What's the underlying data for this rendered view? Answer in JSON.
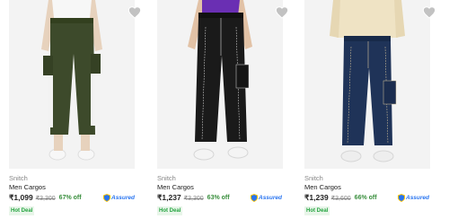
{
  "products": [
    {
      "brand": "Snitch",
      "title": "Men Cargos",
      "price": "₹1,099",
      "mrp": "₹3,300",
      "discount": "67% off",
      "assured": "Assured",
      "deal": "Hot Deal",
      "image": "olive green cargo pants with white side panels",
      "colors": {
        "top": "#f5f5f5",
        "pants": "#3d4a2b",
        "accent": "#eeeeee",
        "shoes": "#f3f3f3"
      }
    },
    {
      "brand": "Snitch",
      "title": "Men Cargos",
      "price": "₹1,237",
      "mrp": "₹3,300",
      "discount": "63% off",
      "assured": "Assured",
      "deal": "Hot Deal",
      "image": "black cargo jeans with contrast stitching",
      "colors": {
        "top": "#6a2fb3",
        "pants": "#1a1a1a",
        "accent": "#d9d9d9",
        "shoes": "#f0f0f0"
      }
    },
    {
      "brand": "Snitch",
      "title": "Men Cargos",
      "price": "₹1,239",
      "mrp": "₹3,600",
      "discount": "66% off",
      "assured": "Assured",
      "deal": "Hot Deal",
      "image": "dark blue denim cargo jeans with contrast stitching",
      "colors": {
        "top": "#efe3c4",
        "pants": "#1f3358",
        "accent": "#d8c59c",
        "shoes": "#ededed"
      }
    }
  ],
  "icons": {
    "wishlist": "heart-icon",
    "assured": "shield-icon"
  },
  "theme": {
    "assured_blue": "#2874f0",
    "discount_green": "#388e3c",
    "deal_bg": "#e8f5e9",
    "deal_text": "#26a541",
    "muted": "#878787"
  }
}
